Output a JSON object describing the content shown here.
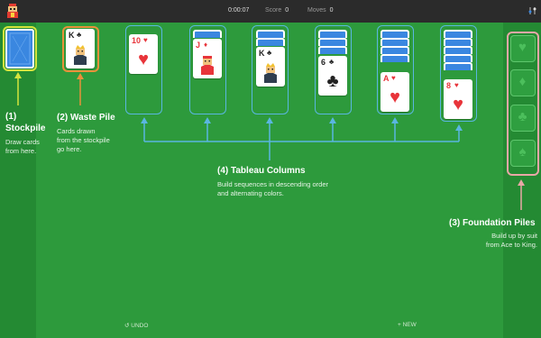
{
  "topbar": {
    "time": "0:00:07",
    "score_label": "Score",
    "score_value": "0",
    "moves_label": "Moves",
    "moves_value": "0"
  },
  "colors": {
    "felt": "#2d9a3c",
    "stockpile_highlight": "#d4e43c",
    "waste_highlight": "#e8913a",
    "tableau_highlight": "#5ab6e0",
    "foundation_highlight": "#e9a7a7",
    "card_back": "#3a87e0"
  },
  "waste_card": {
    "rank": "K",
    "suit": "♣",
    "face": "king-face"
  },
  "tableau": [
    {
      "top_rank": "10",
      "suit": "♥",
      "face_down": 0
    },
    {
      "top_rank": "J",
      "suit": "♦",
      "face_down": 1
    },
    {
      "top_rank": "K",
      "suit": "♣",
      "face_down": 2
    },
    {
      "top_rank": "6",
      "suit": "♣",
      "face_down": 3
    },
    {
      "top_rank": "A",
      "suit": "♥",
      "face_down": 4
    },
    {
      "top_rank": "8",
      "suit": "♥",
      "face_down": 5
    }
  ],
  "foundations": [
    {
      "suit": "♥",
      "icon": "heart-icon"
    },
    {
      "suit": "♦",
      "icon": "diamond-icon"
    },
    {
      "suit": "♣",
      "icon": "club-icon"
    },
    {
      "suit": "♠",
      "icon": "spade-icon"
    }
  ],
  "annotations": {
    "stockpile": {
      "number": "(1)",
      "title": "Stockpile",
      "line1": "Draw cards",
      "line2": "from here."
    },
    "waste": {
      "title": "(2) Waste Pile",
      "line1": "Cards drawn",
      "line2": "from the stockpile",
      "line3": "go here."
    },
    "tableau": {
      "title": "(4) Tableau Columns",
      "line1": "Build sequences in descending order",
      "line2": "and alternating colors."
    },
    "foundation": {
      "title": "(3) Foundation Piles",
      "line1": "Build up by suit",
      "line2": "from Ace to King."
    }
  },
  "controls": {
    "undo_label": "↺ UNDO",
    "new_label": "+ NEW"
  }
}
